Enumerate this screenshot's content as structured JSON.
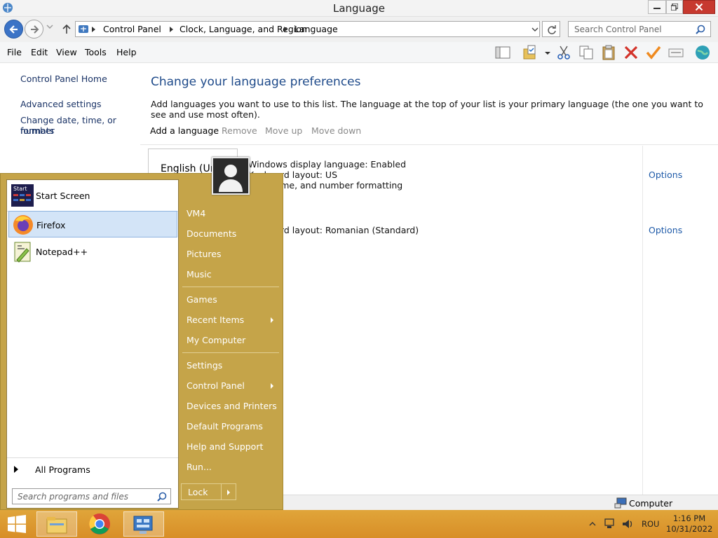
{
  "window": {
    "title": "Language"
  },
  "address": {
    "breadcrumbs": [
      "Control Panel",
      "Clock, Language, and Region",
      "Language"
    ],
    "search_placeholder": "Search Control Panel"
  },
  "menu": [
    "File",
    "Edit",
    "View",
    "Tools",
    "Help"
  ],
  "toolbar_icons": [
    "panel-layout-icon",
    "folder-checklist-icon",
    "dropdown-arrow-icon",
    "cut-icon",
    "copy-icon",
    "paste-icon",
    "delete-icon",
    "checkmark-icon",
    "properties-icon",
    "globe-icon"
  ],
  "leftnav": {
    "home": "Control Panel Home",
    "advanced": "Advanced settings",
    "datetime_line1": "Change date, time, or number",
    "datetime_line2": "formats"
  },
  "main": {
    "heading": "Change your language preferences",
    "description": "Add languages you want to use to this list. The language at the top of your list is your primary language (the one you want to see and use most often).",
    "actions": {
      "add": "Add a language",
      "remove": "Remove",
      "move_up": "Move up",
      "move_down": "Move down"
    },
    "languages": [
      {
        "name": "English (Uni",
        "details": [
          "Windows display language: Enabled",
          "Keyboard layout: US",
          "Date, time, and number formatting"
        ],
        "options": "Options"
      },
      {
        "details": [
          "Keyboard layout: Romanian (Standard)"
        ],
        "options": "Options"
      }
    ]
  },
  "statusbar": {
    "computer": "Computer"
  },
  "startmenu": {
    "programs": [
      {
        "label": "Start Screen",
        "icon": "start-screen-icon"
      },
      {
        "label": "Firefox",
        "icon": "firefox-icon",
        "highlighted": true
      },
      {
        "label": "Notepad++",
        "icon": "notepadpp-icon"
      }
    ],
    "all_programs": "All Programs",
    "search_placeholder": "Search programs and files",
    "right_items": [
      "VM4",
      "Documents",
      "Pictures",
      "Music",
      "Games",
      "Recent Items",
      "My Computer",
      "Settings",
      "Control Panel",
      "Devices and Printers",
      "Default Programs",
      "Help and Support",
      "Run..."
    ],
    "lock": "Lock"
  },
  "taskbar": {
    "apps": [
      "file-explorer-icon",
      "chrome-icon",
      "control-panel-icon"
    ],
    "tray": {
      "language": "ROU",
      "time": "1:16 PM",
      "date": "10/31/2022"
    }
  },
  "colors": {
    "taskbar": "#d88e27",
    "startmenu": "#c5a449",
    "link": "#1e5aa8",
    "heading": "#1e4a8a"
  }
}
